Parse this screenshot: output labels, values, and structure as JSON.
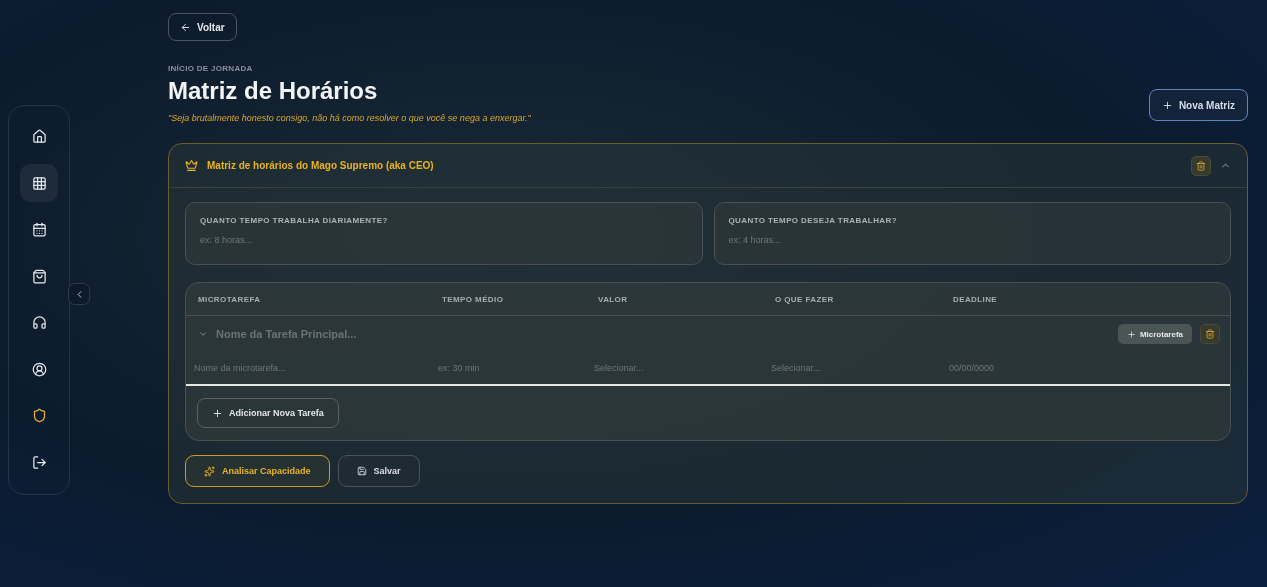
{
  "sidebar": {
    "items": [
      {
        "kind": "home",
        "selected": false,
        "accent": false
      },
      {
        "kind": "grid",
        "selected": true,
        "accent": false
      },
      {
        "kind": "calendar",
        "selected": false,
        "accent": false
      },
      {
        "kind": "bag",
        "selected": false,
        "accent": false
      },
      {
        "kind": "headphones",
        "selected": false,
        "accent": false
      },
      {
        "kind": "user",
        "selected": false,
        "accent": false
      },
      {
        "kind": "shield",
        "selected": false,
        "accent": true
      },
      {
        "kind": "logout",
        "selected": false,
        "accent": false
      }
    ]
  },
  "back_button": "Voltar",
  "eyebrow": "INÍCIO DE JORNADA",
  "title": "Matriz de Horários",
  "quote": "\"Seja brutalmente honesto consigo, não há como resolver o que você se nega a enxergar.\"",
  "new_button": "Nova Matriz",
  "matrix": {
    "title": "Matriz de horários do Mago Supremo (aka CEO)",
    "expanded": true,
    "questions": [
      {
        "label": "QUANTO TEMPO TRABALHA DIARIAMENTE?",
        "placeholder": "ex: 8 horas..."
      },
      {
        "label": "QUANTO TEMPO DESEJA TRABALHAR?",
        "placeholder": "ex: 4 horas..."
      }
    ],
    "columns": [
      "MICROTAREFA",
      "TEMPO MÉDIO",
      "VALOR",
      "O QUE FAZER",
      "DEADLINE"
    ],
    "task": {
      "placeholder": "Nome da Tarefa Principal...",
      "expanded": true,
      "add_button": "Microtarefa",
      "microtasks": [
        {
          "name": "Nome da microtarefa...",
          "time": "ex: 30 min",
          "value": "Selecionar...",
          "action": "Selecionar...",
          "deadline": "00/00/0000"
        }
      ]
    },
    "add_task_button": "Adicionar Nova Tarefa",
    "analyze_button": "Analisar Capacidade",
    "save_button": "Salvar"
  }
}
